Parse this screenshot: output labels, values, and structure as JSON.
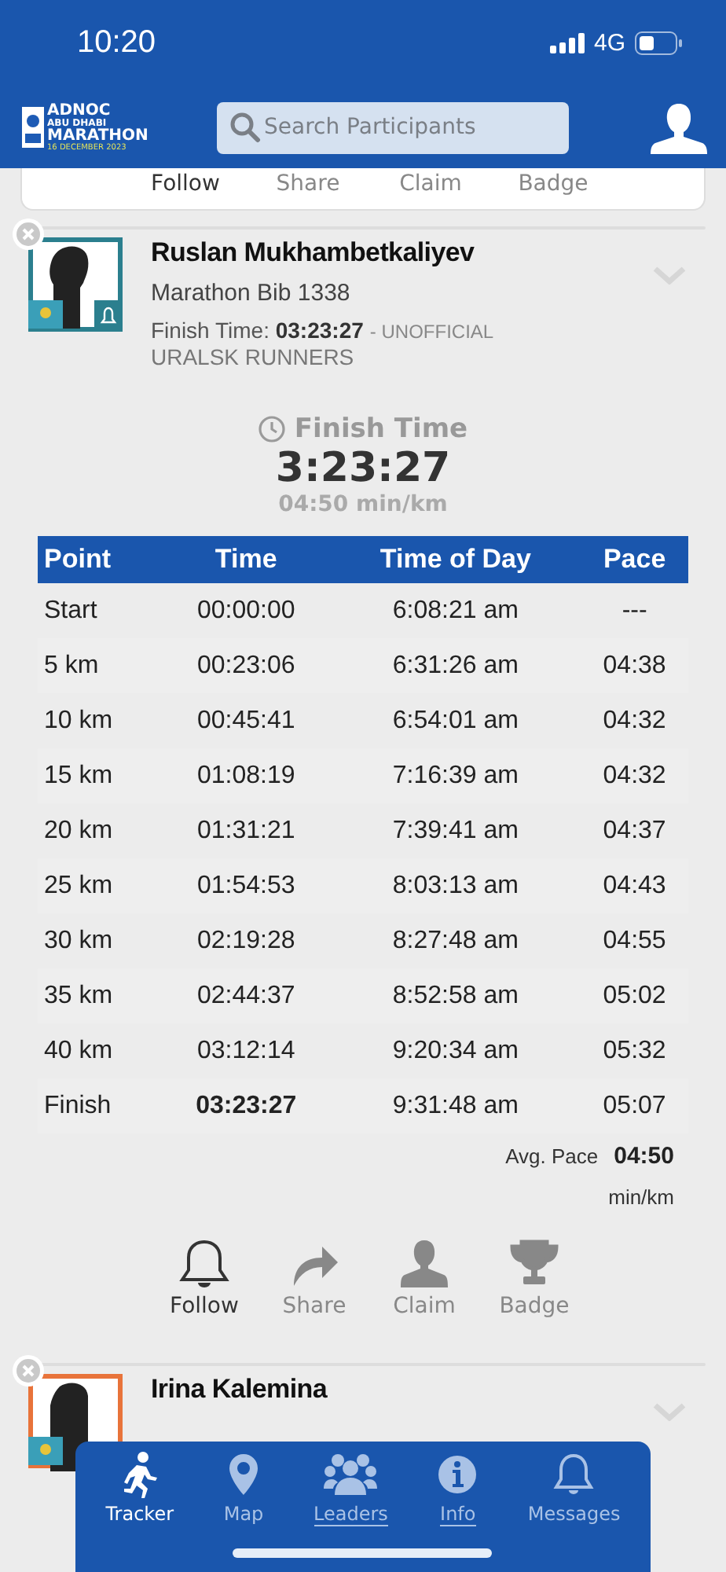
{
  "status_bar": {
    "time": "10:20",
    "network": "4G"
  },
  "header": {
    "logo": {
      "line_1": "ADNOC",
      "line_2": "ABU DHABI",
      "line_3": "MARATHON",
      "date": "16 DECEMBER 2023"
    },
    "search": {
      "placeholder": "Search Participants"
    }
  },
  "previous_card": {
    "actions": [
      {
        "label": "Follow",
        "selected": true
      },
      {
        "label": "Share",
        "selected": false
      },
      {
        "label": "Claim",
        "selected": false
      },
      {
        "label": "Badge",
        "selected": false
      }
    ]
  },
  "runner_card": {
    "name": "Ruslan Mukhambetkaliyev",
    "bib": "Marathon Bib 1338",
    "finish_label": "Finish Time:",
    "finish_value": "03:23:27",
    "finish_note": "- UNOFFICIAL",
    "team": "URALSK RUNNERS",
    "summary": {
      "title": "Finish Time",
      "time": "3:23:27",
      "pace": "04:50 min/km"
    },
    "splits": {
      "columns": [
        "Point",
        "Time",
        "Time of Day",
        "Pace"
      ],
      "rows": [
        {
          "cells": [
            "Start",
            "00:00:00",
            "6:08:21 am",
            "---"
          ],
          "bold_time": false
        },
        {
          "cells": [
            "5 km",
            "00:23:06",
            "6:31:26 am",
            "04:38"
          ],
          "bold_time": false
        },
        {
          "cells": [
            "10 km",
            "00:45:41",
            "6:54:01 am",
            "04:32"
          ],
          "bold_time": false
        },
        {
          "cells": [
            "15 km",
            "01:08:19",
            "7:16:39 am",
            "04:32"
          ],
          "bold_time": false
        },
        {
          "cells": [
            "20 km",
            "01:31:21",
            "7:39:41 am",
            "04:37"
          ],
          "bold_time": false
        },
        {
          "cells": [
            "25 km",
            "01:54:53",
            "8:03:13 am",
            "04:43"
          ],
          "bold_time": false
        },
        {
          "cells": [
            "30 km",
            "02:19:28",
            "8:27:48 am",
            "04:55"
          ],
          "bold_time": false
        },
        {
          "cells": [
            "35 km",
            "02:44:37",
            "8:52:58 am",
            "05:02"
          ],
          "bold_time": false
        },
        {
          "cells": [
            "40 km",
            "03:12:14",
            "9:20:34 am",
            "05:32"
          ],
          "bold_time": false
        },
        {
          "cells": [
            "Finish",
            "03:23:27",
            "9:31:48 am",
            "05:07"
          ],
          "bold_time": true
        }
      ]
    },
    "avg_pace": {
      "label": "Avg. Pace",
      "value": "04:50",
      "unit": "min/km"
    },
    "actions": [
      {
        "kind": "follow",
        "label": "Follow",
        "selected": true
      },
      {
        "kind": "share",
        "label": "Share",
        "selected": false
      },
      {
        "kind": "claim",
        "label": "Claim",
        "selected": false
      },
      {
        "kind": "badge",
        "label": "Badge",
        "selected": false
      }
    ]
  },
  "next_card": {
    "name": "Irina Kalemina"
  },
  "bottom_nav": [
    {
      "kind": "tracker",
      "label": "Tracker",
      "selected": true,
      "underlined": false
    },
    {
      "kind": "map",
      "label": "Map",
      "selected": false,
      "underlined": false
    },
    {
      "kind": "leaders",
      "label": "Leaders",
      "selected": false,
      "underlined": true
    },
    {
      "kind": "info",
      "label": "Info",
      "selected": false,
      "underlined": true
    },
    {
      "kind": "messages",
      "label": "Messages",
      "selected": false,
      "underlined": false
    }
  ]
}
